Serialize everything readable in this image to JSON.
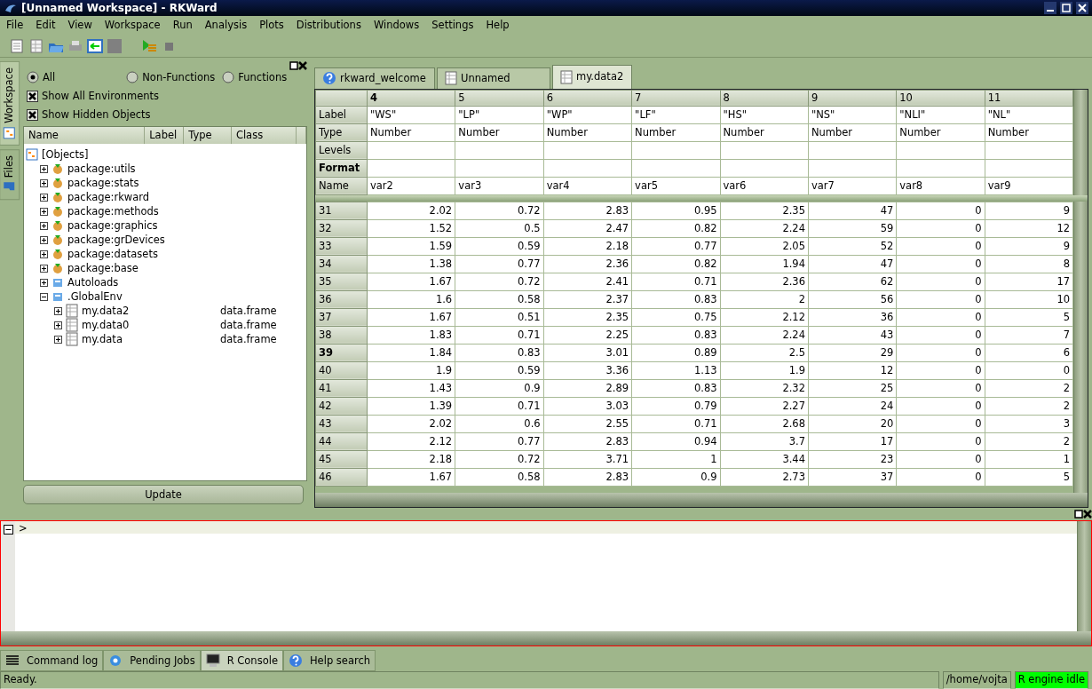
{
  "window": {
    "title": "[Unnamed Workspace] - RKWard"
  },
  "menu": [
    "File",
    "Edit",
    "View",
    "Workspace",
    "Run",
    "Analysis",
    "Plots",
    "Distributions",
    "Windows",
    "Settings",
    "Help"
  ],
  "side_tabs": [
    {
      "label": "Workspace",
      "selected": true
    },
    {
      "label": "Files",
      "selected": false
    }
  ],
  "workspace": {
    "filters": [
      {
        "label": "All",
        "selected": true
      },
      {
        "label": "Non-Functions",
        "selected": false
      },
      {
        "label": "Functions",
        "selected": false
      }
    ],
    "options": [
      {
        "label": "Show All Environments",
        "checked": true
      },
      {
        "label": "Show Hidden Objects",
        "checked": true
      }
    ],
    "columns": [
      "Name",
      "Label",
      "Type",
      "Class"
    ],
    "tree": [
      {
        "name": "[Objects]",
        "kind": "root",
        "children": [
          {
            "name": "package:utils",
            "kind": "package",
            "expanded": false
          },
          {
            "name": "package:stats",
            "kind": "package",
            "expanded": false
          },
          {
            "name": "package:rkward",
            "kind": "package",
            "expanded": false
          },
          {
            "name": "package:methods",
            "kind": "package",
            "expanded": false
          },
          {
            "name": "package:graphics",
            "kind": "package",
            "expanded": false
          },
          {
            "name": "package:grDevices",
            "kind": "package",
            "expanded": false
          },
          {
            "name": "package:datasets",
            "kind": "package",
            "expanded": false
          },
          {
            "name": "package:base",
            "kind": "package",
            "expanded": false
          },
          {
            "name": "Autoloads",
            "kind": "env",
            "expanded": false
          },
          {
            "name": ".GlobalEnv",
            "kind": "env",
            "expanded": true,
            "children": [
              {
                "name": "my.data2",
                "kind": "frame",
                "class": "data.frame",
                "expanded": false
              },
              {
                "name": "my.data0",
                "kind": "frame",
                "class": "data.frame",
                "expanded": false
              },
              {
                "name": "my.data",
                "kind": "frame",
                "class": "data.frame",
                "expanded": false
              }
            ]
          }
        ]
      }
    ],
    "update_button": "Update"
  },
  "doc_tabs": [
    {
      "label": "rkward_welcome",
      "kind": "help",
      "selected": false
    },
    {
      "label": "Unnamed",
      "kind": "sheet",
      "selected": false
    },
    {
      "label": "my.data2",
      "kind": "sheet",
      "selected": true
    }
  ],
  "editor": {
    "meta_rows": [
      {
        "label": "Label",
        "current": false
      },
      {
        "label": "Type",
        "current": false
      },
      {
        "label": "Levels",
        "current": false
      },
      {
        "label": "Format",
        "current": true
      },
      {
        "label": "Name",
        "current": false
      }
    ],
    "columns": [
      {
        "index": "4",
        "current": true,
        "label": "\"WS\"",
        "type": "Number",
        "name": "var2"
      },
      {
        "index": "5",
        "current": false,
        "label": "\"LP\"",
        "type": "Number",
        "name": "var3"
      },
      {
        "index": "6",
        "current": false,
        "label": "\"WP\"",
        "type": "Number",
        "name": "var4"
      },
      {
        "index": "7",
        "current": false,
        "label": "\"LF\"",
        "type": "Number",
        "name": "var5"
      },
      {
        "index": "8",
        "current": false,
        "label": "\"HS\"",
        "type": "Number",
        "name": "var6"
      },
      {
        "index": "9",
        "current": false,
        "label": "\"NS\"",
        "type": "Number",
        "name": "var7"
      },
      {
        "index": "10",
        "current": false,
        "label": "\"NLI\"",
        "type": "Number",
        "name": "var8"
      },
      {
        "index": "11",
        "current": false,
        "label": "\"NL\"",
        "type": "Number",
        "name": "var9"
      }
    ],
    "rows": [
      {
        "number": "31",
        "current": false,
        "cells": [
          "2.02",
          "0.72",
          "2.83",
          "0.95",
          "2.35",
          "47",
          "0",
          "9"
        ]
      },
      {
        "number": "32",
        "current": false,
        "cells": [
          "1.52",
          "0.5",
          "2.47",
          "0.82",
          "2.24",
          "59",
          "0",
          "12"
        ]
      },
      {
        "number": "33",
        "current": false,
        "cells": [
          "1.59",
          "0.59",
          "2.18",
          "0.77",
          "2.05",
          "52",
          "0",
          "9"
        ]
      },
      {
        "number": "34",
        "current": false,
        "cells": [
          "1.38",
          "0.77",
          "2.36",
          "0.82",
          "1.94",
          "47",
          "0",
          "8"
        ]
      },
      {
        "number": "35",
        "current": false,
        "cells": [
          "1.67",
          "0.72",
          "2.41",
          "0.71",
          "2.36",
          "62",
          "0",
          "17"
        ]
      },
      {
        "number": "36",
        "current": false,
        "cells": [
          "1.6",
          "0.58",
          "2.37",
          "0.83",
          "2",
          "56",
          "0",
          "10"
        ]
      },
      {
        "number": "37",
        "current": false,
        "cells": [
          "1.67",
          "0.51",
          "2.35",
          "0.75",
          "2.12",
          "36",
          "0",
          "5"
        ]
      },
      {
        "number": "38",
        "current": false,
        "cells": [
          "1.83",
          "0.71",
          "2.25",
          "0.83",
          "2.24",
          "43",
          "0",
          "7"
        ]
      },
      {
        "number": "39",
        "current": true,
        "cells": [
          "1.84",
          "0.83",
          "3.01",
          "0.89",
          "2.5",
          "29",
          "0",
          "6"
        ]
      },
      {
        "number": "40",
        "current": false,
        "cells": [
          "1.9",
          "0.59",
          "3.36",
          "1.13",
          "1.9",
          "12",
          "0",
          "0"
        ]
      },
      {
        "number": "41",
        "current": false,
        "cells": [
          "1.43",
          "0.9",
          "2.89",
          "0.83",
          "2.32",
          "25",
          "0",
          "2"
        ]
      },
      {
        "number": "42",
        "current": false,
        "cells": [
          "1.39",
          "0.71",
          "3.03",
          "0.79",
          "2.27",
          "24",
          "0",
          "2"
        ]
      },
      {
        "number": "43",
        "current": false,
        "cells": [
          "2.02",
          "0.6",
          "2.55",
          "0.71",
          "2.68",
          "20",
          "0",
          "3"
        ]
      },
      {
        "number": "44",
        "current": false,
        "cells": [
          "2.12",
          "0.77",
          "2.83",
          "0.94",
          "3.7",
          "17",
          "0",
          "2"
        ]
      },
      {
        "number": "45",
        "current": false,
        "cells": [
          "2.18",
          "0.72",
          "3.71",
          "1",
          "3.44",
          "23",
          "0",
          "1"
        ]
      },
      {
        "number": "46",
        "current": false,
        "cells": [
          "1.67",
          "0.58",
          "2.83",
          "0.9",
          "2.73",
          "37",
          "0",
          "5"
        ]
      }
    ]
  },
  "console": {
    "prompt": ">"
  },
  "bottom_tabs": [
    {
      "label": "Command log",
      "kind": "log",
      "selected": false
    },
    {
      "label": "Pending Jobs",
      "kind": "jobs",
      "selected": false
    },
    {
      "label": "R Console",
      "kind": "console",
      "selected": true
    },
    {
      "label": "Help search",
      "kind": "help",
      "selected": false
    }
  ],
  "status": {
    "message": "Ready.",
    "directory": "/home/vojta",
    "engine": "R engine idle"
  }
}
